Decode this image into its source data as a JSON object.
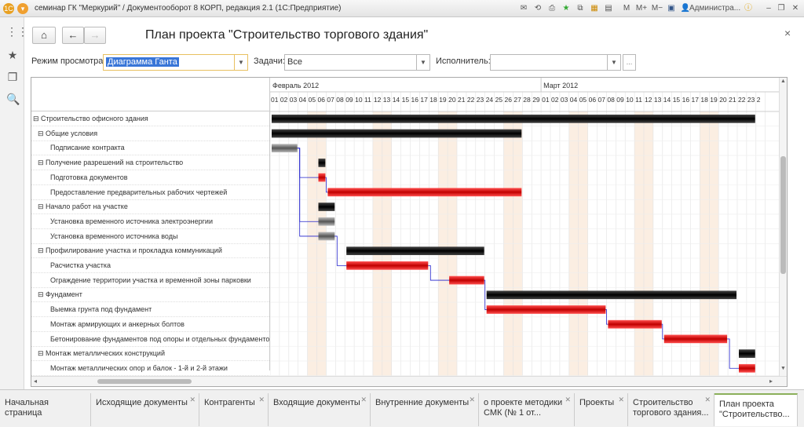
{
  "window": {
    "title": "семинар ГК \"Меркурий\" / Документооборот 8 КОРП, редакция 2.1  (1С:Предприятие)",
    "user": "Администра..."
  },
  "page": {
    "title": "План проекта \"Строительство торгового здания\"",
    "view_mode_label": "Режим просмотра:",
    "view_mode_value": "Диаграмма Ганта",
    "tasks_label": "Задачи:",
    "tasks_value": "Все",
    "executor_label": "Исполнитель:",
    "executor_value": ""
  },
  "timeline": {
    "month1": "Февраль 2012",
    "month2": "Март 2012",
    "days": [
      "01",
      "02",
      "03",
      "04",
      "05",
      "06",
      "07",
      "08",
      "09",
      "10",
      "11",
      "12",
      "13",
      "14",
      "15",
      "16",
      "17",
      "18",
      "19",
      "20",
      "21",
      "22",
      "23",
      "24",
      "25",
      "26",
      "27",
      "28",
      "29",
      "01",
      "02",
      "03",
      "04",
      "05",
      "06",
      "07",
      "08",
      "09",
      "10",
      "11",
      "12",
      "13",
      "14",
      "15",
      "16",
      "17",
      "18",
      "19",
      "20",
      "21",
      "22",
      "23",
      "2"
    ]
  },
  "tasks": [
    {
      "name": "Строительство офисного здания",
      "level": 0,
      "group": true
    },
    {
      "name": "Общие условия",
      "level": 1,
      "group": true
    },
    {
      "name": "Подписание контракта",
      "level": 2,
      "group": false
    },
    {
      "name": "Получение разрешений на строительство",
      "level": 1,
      "group": true
    },
    {
      "name": "Подготовка документов",
      "level": 2,
      "group": false
    },
    {
      "name": "Предоставление предварительных рабочих чертежей",
      "level": 2,
      "group": false
    },
    {
      "name": "Начало работ на участке",
      "level": 1,
      "group": true
    },
    {
      "name": "Установка временного источника электроэнергии",
      "level": 2,
      "group": false
    },
    {
      "name": "Установка временного источника воды",
      "level": 2,
      "group": false
    },
    {
      "name": "Профилирование участка и прокладка коммуникаций",
      "level": 1,
      "group": true
    },
    {
      "name": "Расчистка участка",
      "level": 2,
      "group": false
    },
    {
      "name": "Ограждение территории участка и временной зоны парковки",
      "level": 2,
      "group": false
    },
    {
      "name": "Фундамент",
      "level": 1,
      "group": true
    },
    {
      "name": "Выемка грунта под фундамент",
      "level": 2,
      "group": false
    },
    {
      "name": "Монтаж армирующих и анкерных болтов",
      "level": 2,
      "group": false
    },
    {
      "name": "Бетонирование фундаментов под опоры и отдельных фундаментов",
      "level": 2,
      "group": false
    },
    {
      "name": "Монтаж металлических конструкций",
      "level": 1,
      "group": true
    },
    {
      "name": "Монтаж металлических опор и балок - 1-й и 2-й этажи",
      "level": 2,
      "group": false
    }
  ],
  "bars": [
    {
      "row": 0,
      "start": "01.02",
      "end": "23.03",
      "color": "black"
    },
    {
      "row": 1,
      "start": "01.02",
      "end": "27.02",
      "color": "black"
    },
    {
      "row": 2,
      "start": "01.02",
      "end": "03.02",
      "color": "gray"
    },
    {
      "row": 3,
      "start": "06.02",
      "end": "06.02",
      "color": "black"
    },
    {
      "row": 4,
      "start": "06.02",
      "end": "06.02",
      "color": "red"
    },
    {
      "row": 5,
      "start": "07.02",
      "end": "27.02",
      "color": "red"
    },
    {
      "row": 6,
      "start": "06.02",
      "end": "07.02",
      "color": "black"
    },
    {
      "row": 7,
      "start": "06.02",
      "end": "07.02",
      "color": "gray"
    },
    {
      "row": 8,
      "start": "06.02",
      "end": "07.02",
      "color": "gray"
    },
    {
      "row": 9,
      "start": "09.02",
      "end": "23.02",
      "color": "black"
    },
    {
      "row": 10,
      "start": "09.02",
      "end": "17.02",
      "color": "red"
    },
    {
      "row": 11,
      "start": "20.02",
      "end": "23.02",
      "color": "red"
    },
    {
      "row": 12,
      "start": "24.02",
      "end": "21.03",
      "color": "black"
    },
    {
      "row": 13,
      "start": "24.02",
      "end": "07.03",
      "color": "red"
    },
    {
      "row": 14,
      "start": "08.03",
      "end": "13.03",
      "color": "red"
    },
    {
      "row": 15,
      "start": "14.03",
      "end": "20.03",
      "color": "red"
    },
    {
      "row": 16,
      "start": "22.03",
      "end": "23.03",
      "color": "black"
    },
    {
      "row": 17,
      "start": "22.03",
      "end": "23.03",
      "color": "red"
    }
  ],
  "bottom_tabs": [
    {
      "label": "Начальная страница",
      "closable": false
    },
    {
      "label": "Исходящие документы",
      "closable": true
    },
    {
      "label": "Контрагенты",
      "closable": true
    },
    {
      "label": "Входящие документы",
      "closable": true
    },
    {
      "label": "Внутренние документы",
      "closable": true
    },
    {
      "label": "о проекте методики СМК (№ 1 от...",
      "closable": true
    },
    {
      "label": "Проекты",
      "closable": true
    },
    {
      "label": "Строительство торгового здания...",
      "closable": true
    },
    {
      "label": "План проекта \"Строительство...",
      "closable": false,
      "active": true
    }
  ],
  "colors": {
    "bar_black": "#111111",
    "bar_red": "#e00000",
    "bar_gray": "#777777",
    "weekend": "#fbeee2",
    "link": "#2222cc"
  }
}
